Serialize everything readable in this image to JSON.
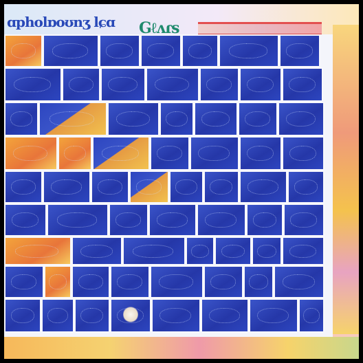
{
  "header": {
    "title": "ɑpholɒoʊnʒ lɕɑ",
    "title_2": "Gℓʌɾs"
  },
  "colors": {
    "tile_blue": "#2d46c0",
    "tile_border": "#f7f7fc",
    "accent_orange": "#f3a43b",
    "accent_yellow": "#f6d36b"
  }
}
